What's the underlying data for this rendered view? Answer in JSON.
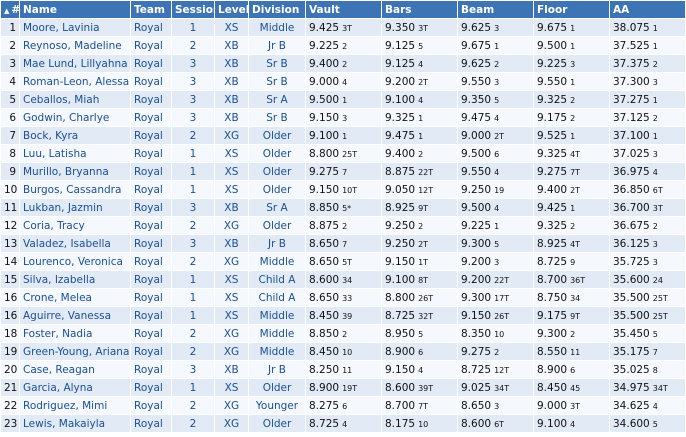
{
  "headers": {
    "place": "#",
    "name": "Name",
    "team": "Team",
    "session": "Session",
    "level": "Level",
    "division": "Division",
    "vault": "Vault",
    "bars": "Bars",
    "beam": "Beam",
    "floor": "Floor",
    "aa": "AA"
  },
  "rows": [
    {
      "place": "1",
      "name": "Moore, Lavinia",
      "team": "Royal",
      "session": "1",
      "level": "XS",
      "division": "Middle",
      "vault": "9.425",
      "vault_rank": "3T",
      "bars": "9.350",
      "bars_rank": "3T",
      "beam": "9.625",
      "beam_rank": "3",
      "floor": "9.675",
      "floor_rank": "1",
      "aa": "38.075",
      "aa_rank": "1"
    },
    {
      "place": "2",
      "name": "Reynoso, Madeline",
      "team": "Royal",
      "session": "2",
      "level": "XB",
      "division": "Jr B",
      "vault": "9.225",
      "vault_rank": "2",
      "bars": "9.125",
      "bars_rank": "5",
      "beam": "9.675",
      "beam_rank": "1",
      "floor": "9.500",
      "floor_rank": "1",
      "aa": "37.525",
      "aa_rank": "1"
    },
    {
      "place": "3",
      "name": "Mae Lund, Lillyahna",
      "team": "Royal",
      "session": "3",
      "level": "XB",
      "division": "Sr B",
      "vault": "9.400",
      "vault_rank": "2",
      "bars": "9.125",
      "bars_rank": "4",
      "beam": "9.625",
      "beam_rank": "2",
      "floor": "9.225",
      "floor_rank": "3",
      "aa": "37.375",
      "aa_rank": "2"
    },
    {
      "place": "4",
      "name": "Roman-Leon, Alessa",
      "team": "Royal",
      "session": "3",
      "level": "XB",
      "division": "Sr B",
      "vault": "9.000",
      "vault_rank": "4",
      "bars": "9.200",
      "bars_rank": "2T",
      "beam": "9.550",
      "beam_rank": "3",
      "floor": "9.550",
      "floor_rank": "1",
      "aa": "37.300",
      "aa_rank": "3"
    },
    {
      "place": "5",
      "name": "Ceballos, Miah",
      "team": "Royal",
      "session": "3",
      "level": "XB",
      "division": "Sr A",
      "vault": "9.500",
      "vault_rank": "1",
      "bars": "9.100",
      "bars_rank": "4",
      "beam": "9.350",
      "beam_rank": "5",
      "floor": "9.325",
      "floor_rank": "2",
      "aa": "37.275",
      "aa_rank": "1"
    },
    {
      "place": "6",
      "name": "Godwin, Charlye",
      "team": "Royal",
      "session": "3",
      "level": "XB",
      "division": "Sr B",
      "vault": "9.150",
      "vault_rank": "3",
      "bars": "9.325",
      "bars_rank": "1",
      "beam": "9.475",
      "beam_rank": "4",
      "floor": "9.175",
      "floor_rank": "2",
      "aa": "37.125",
      "aa_rank": "2"
    },
    {
      "place": "7",
      "name": "Bock, Kyra",
      "team": "Royal",
      "session": "2",
      "level": "XG",
      "division": "Older",
      "vault": "9.100",
      "vault_rank": "1",
      "bars": "9.475",
      "bars_rank": "1",
      "beam": "9.000",
      "beam_rank": "2T",
      "floor": "9.525",
      "floor_rank": "1",
      "aa": "37.100",
      "aa_rank": "1"
    },
    {
      "place": "8",
      "name": "Luu, Latisha",
      "team": "Royal",
      "session": "1",
      "level": "XS",
      "division": "Older",
      "vault": "8.800",
      "vault_rank": "25T",
      "bars": "9.400",
      "bars_rank": "2",
      "beam": "9.500",
      "beam_rank": "6",
      "floor": "9.325",
      "floor_rank": "4T",
      "aa": "37.025",
      "aa_rank": "3"
    },
    {
      "place": "9",
      "name": "Murillo, Bryanna",
      "team": "Royal",
      "session": "1",
      "level": "XS",
      "division": "Older",
      "vault": "9.275",
      "vault_rank": "7",
      "bars": "8.875",
      "bars_rank": "22T",
      "beam": "9.550",
      "beam_rank": "4",
      "floor": "9.275",
      "floor_rank": "7T",
      "aa": "36.975",
      "aa_rank": "4"
    },
    {
      "place": "10",
      "name": "Burgos, Cassandra",
      "team": "Royal",
      "session": "1",
      "level": "XS",
      "division": "Older",
      "vault": "9.150",
      "vault_rank": "10T",
      "bars": "9.050",
      "bars_rank": "12T",
      "beam": "9.250",
      "beam_rank": "19",
      "floor": "9.400",
      "floor_rank": "2T",
      "aa": "36.850",
      "aa_rank": "6T"
    },
    {
      "place": "11",
      "name": "Lukban, Jazmin",
      "team": "Royal",
      "session": "3",
      "level": "XB",
      "division": "Sr A",
      "vault": "8.850",
      "vault_rank": "5*",
      "bars": "8.925",
      "bars_rank": "9T",
      "beam": "9.500",
      "beam_rank": "4",
      "floor": "9.425",
      "floor_rank": "1",
      "aa": "36.700",
      "aa_rank": "3T"
    },
    {
      "place": "12",
      "name": "Coria, Tracy",
      "team": "Royal",
      "session": "2",
      "level": "XG",
      "division": "Older",
      "vault": "8.875",
      "vault_rank": "2",
      "bars": "9.250",
      "bars_rank": "2",
      "beam": "9.225",
      "beam_rank": "1",
      "floor": "9.325",
      "floor_rank": "2",
      "aa": "36.675",
      "aa_rank": "2"
    },
    {
      "place": "13",
      "name": "Valadez, Isabella",
      "team": "Royal",
      "session": "3",
      "level": "XB",
      "division": "Jr B",
      "vault": "8.650",
      "vault_rank": "7",
      "bars": "9.250",
      "bars_rank": "2T",
      "beam": "9.300",
      "beam_rank": "5",
      "floor": "8.925",
      "floor_rank": "4T",
      "aa": "36.125",
      "aa_rank": "3"
    },
    {
      "place": "14",
      "name": "Lourenco, Veronica",
      "team": "Royal",
      "session": "2",
      "level": "XG",
      "division": "Middle",
      "vault": "8.650",
      "vault_rank": "5T",
      "bars": "9.150",
      "bars_rank": "1T",
      "beam": "9.200",
      "beam_rank": "3",
      "floor": "8.725",
      "floor_rank": "9",
      "aa": "35.725",
      "aa_rank": "3"
    },
    {
      "place": "15",
      "name": "Silva, Izabella",
      "team": "Royal",
      "session": "1",
      "level": "XS",
      "division": "Child A",
      "vault": "8.600",
      "vault_rank": "34",
      "bars": "9.100",
      "bars_rank": "8T",
      "beam": "9.200",
      "beam_rank": "22T",
      "floor": "8.700",
      "floor_rank": "36T",
      "aa": "35.600",
      "aa_rank": "24"
    },
    {
      "place": "16",
      "name": "Crone, Melea",
      "team": "Royal",
      "session": "1",
      "level": "XS",
      "division": "Child A",
      "vault": "8.650",
      "vault_rank": "33",
      "bars": "8.800",
      "bars_rank": "26T",
      "beam": "9.300",
      "beam_rank": "17T",
      "floor": "8.750",
      "floor_rank": "34",
      "aa": "35.500",
      "aa_rank": "25T"
    },
    {
      "place": "16",
      "name": "Aguirre, Vanessa",
      "team": "Royal",
      "session": "1",
      "level": "XS",
      "division": "Middle",
      "vault": "8.450",
      "vault_rank": "39",
      "bars": "8.725",
      "bars_rank": "32T",
      "beam": "9.150",
      "beam_rank": "26T",
      "floor": "9.175",
      "floor_rank": "9T",
      "aa": "35.500",
      "aa_rank": "25T"
    },
    {
      "place": "18",
      "name": "Foster, Nadia",
      "team": "Royal",
      "session": "2",
      "level": "XG",
      "division": "Middle",
      "vault": "8.850",
      "vault_rank": "2",
      "bars": "8.950",
      "bars_rank": "5",
      "beam": "8.350",
      "beam_rank": "10",
      "floor": "9.300",
      "floor_rank": "2",
      "aa": "35.450",
      "aa_rank": "5"
    },
    {
      "place": "19",
      "name": "Green-Young, Ariana",
      "team": "Royal",
      "session": "2",
      "level": "XG",
      "division": "Middle",
      "vault": "8.450",
      "vault_rank": "10",
      "bars": "8.900",
      "bars_rank": "6",
      "beam": "9.275",
      "beam_rank": "2",
      "floor": "8.550",
      "floor_rank": "11",
      "aa": "35.175",
      "aa_rank": "7"
    },
    {
      "place": "20",
      "name": "Case, Reagan",
      "team": "Royal",
      "session": "3",
      "level": "XB",
      "division": "Jr B",
      "vault": "8.250",
      "vault_rank": "11",
      "bars": "9.150",
      "bars_rank": "4",
      "beam": "8.725",
      "beam_rank": "12T",
      "floor": "8.900",
      "floor_rank": "6",
      "aa": "35.025",
      "aa_rank": "8"
    },
    {
      "place": "21",
      "name": "Garcia, Alyna",
      "team": "Royal",
      "session": "1",
      "level": "XS",
      "division": "Older",
      "vault": "8.900",
      "vault_rank": "19T",
      "bars": "8.600",
      "bars_rank": "39T",
      "beam": "9.025",
      "beam_rank": "34T",
      "floor": "8.450",
      "floor_rank": "45",
      "aa": "34.975",
      "aa_rank": "34T"
    },
    {
      "place": "22",
      "name": "Rodriguez, Mimi",
      "team": "Royal",
      "session": "2",
      "level": "XG",
      "division": "Younger",
      "vault": "8.275",
      "vault_rank": "6",
      "bars": "8.700",
      "bars_rank": "7T",
      "beam": "8.650",
      "beam_rank": "3",
      "floor": "9.000",
      "floor_rank": "3T",
      "aa": "34.625",
      "aa_rank": "4"
    },
    {
      "place": "23",
      "name": "Lewis, Makaiyla",
      "team": "Royal",
      "session": "2",
      "level": "XG",
      "division": "Older",
      "vault": "8.725",
      "vault_rank": "4",
      "bars": "8.175",
      "bars_rank": "10",
      "beam": "8.600",
      "beam_rank": "6T",
      "floor": "9.100",
      "floor_rank": "4",
      "aa": "34.600",
      "aa_rank": "5"
    }
  ]
}
